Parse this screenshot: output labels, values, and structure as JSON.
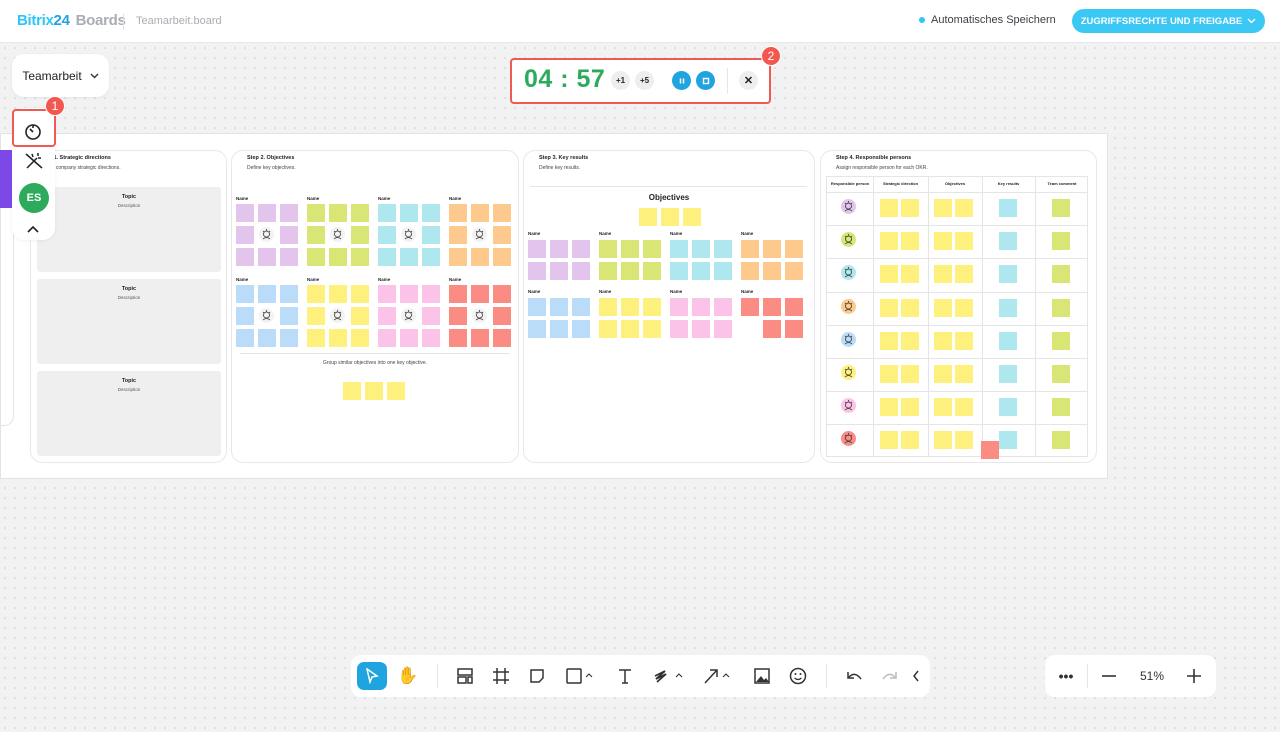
{
  "header": {
    "logo_brand": "Bitrix",
    "logo_num": "24",
    "logo_product": "Boards",
    "file_name": "Teamarbeit.board",
    "save_status": "Automatisches Speichern",
    "share_button": "ZUGRIFFSRECHTE UND FREIGABE"
  },
  "board_selector": {
    "label": "Teamarbeit"
  },
  "sidebar": {
    "user_initials": "ES",
    "badge": "1"
  },
  "timer": {
    "time": "04 : 57",
    "add1": "+1",
    "add5": "+5",
    "badge": "2"
  },
  "colors": {
    "purple": "#e2c4ec",
    "lime": "#d9e575",
    "cyan": "#afe7ef",
    "orange": "#fdc98c",
    "blue": "#badcf8",
    "yellow": "#fdf07c",
    "pink": "#fcc3e8",
    "red": "#fa8c84",
    "accent": "#3bc8f5",
    "timer_green": "#2eaa5c"
  },
  "frames": {
    "step1": {
      "title": "Step 1. Strategic directions",
      "subtitle": "Define company strategic directions.",
      "cards": [
        {
          "title": "Topic",
          "desc": "Description"
        },
        {
          "title": "Topic",
          "desc": "Description"
        },
        {
          "title": "Topic",
          "desc": "Description"
        }
      ]
    },
    "step2": {
      "title": "Step 2. Objectives",
      "subtitle": "Define key objectives.",
      "group_label": "Name",
      "footer": "Group similar objectives into one key objective."
    },
    "step3": {
      "title": "Step 3. Key results",
      "subtitle": "Define key results.",
      "heading": "Objectives",
      "group_label": "Name"
    },
    "step4": {
      "title": "Step 4. Responsible persons",
      "subtitle": "Assign responsible person for each OKR.",
      "columns": [
        "Responsible person",
        "Strategic direction",
        "Objectives",
        "Key results",
        "Team comment"
      ]
    }
  },
  "zoom": {
    "level": "51%"
  }
}
